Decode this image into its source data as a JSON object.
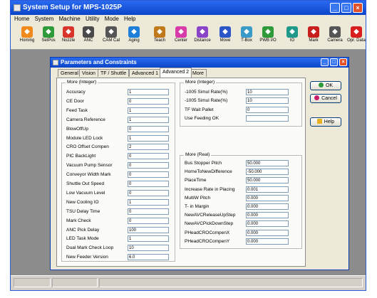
{
  "app": {
    "title": "System Setup for MPS-1025P",
    "menu": [
      "Home",
      "System",
      "Machine",
      "Utility",
      "Mode",
      "Help"
    ]
  },
  "toolbar": [
    {
      "label": "Homing",
      "icon": "home-icon",
      "color": "#f08a1c"
    },
    {
      "label": "SetPos",
      "icon": "person-icon",
      "color": "#2e9a3a"
    },
    {
      "label": "Nozzle",
      "icon": "nozzle-icon",
      "color": "#d8342a"
    },
    {
      "label": "ANC",
      "icon": "anc-icon",
      "color": "#4a4a4a"
    },
    {
      "label": "CAM Cal",
      "icon": "camera-icon",
      "color": "#555555"
    },
    {
      "label": "Aging",
      "icon": "aging-icon",
      "color": "#1e7fd8"
    },
    {
      "label": "Teach",
      "icon": "teach-icon",
      "color": "#c07a1c"
    },
    {
      "label": "Center",
      "icon": "center-icon",
      "color": "#d83aa8"
    },
    {
      "label": "Distance",
      "icon": "distance-icon",
      "color": "#8a44c8"
    },
    {
      "label": "Move",
      "icon": "move-icon",
      "color": "#2a56c8"
    },
    {
      "label": "T-Box",
      "icon": "tbox-icon",
      "color": "#3a9ac8"
    },
    {
      "label": "PWB I/O",
      "icon": "pwb-icon",
      "color": "#2e9a3a"
    },
    {
      "label": "IO",
      "icon": "io-icon",
      "color": "#1f9a8a"
    },
    {
      "label": "Mark",
      "icon": "mark-icon",
      "color": "#c81e1e"
    },
    {
      "label": "Camera",
      "icon": "camera2-icon",
      "color": "#555555"
    },
    {
      "label": "Opr. Data",
      "icon": "data-icon",
      "color": "#d81e1e"
    }
  ],
  "dialog": {
    "title": "Parameters and Constraints",
    "tabs": [
      "General",
      "Vision",
      "TF / Shuttle",
      "Advanced 1",
      "Advanced 2",
      "More"
    ],
    "active_tab": "Advanced 2",
    "buttons": {
      "ok": "OK",
      "cancel": "Cancel",
      "help": "Help"
    },
    "more_integer": {
      "title": "More (Integer)",
      "rows": [
        {
          "label": "Accuracy",
          "value": "1"
        },
        {
          "label": "CE Door",
          "value": "0"
        },
        {
          "label": "Feed Task",
          "value": "1"
        },
        {
          "label": "Camera Reference",
          "value": "1"
        },
        {
          "label": "BlowOffUp",
          "value": "0"
        },
        {
          "label": "Module LED Lock",
          "value": "1"
        },
        {
          "label": "CRO Offset Compen",
          "value": "2"
        },
        {
          "label": "PIC BackLight",
          "value": "0"
        },
        {
          "label": "Vacuum Pump Sensor",
          "value": "0"
        },
        {
          "label": "Conveyor Width Mark",
          "value": "0"
        },
        {
          "label": "Shuttle Out Speed",
          "value": "0"
        },
        {
          "label": "Low Vacuum Level",
          "value": "0"
        },
        {
          "label": "New Cooling IO",
          "value": "1"
        },
        {
          "label": "TSU Delay Time",
          "value": "0"
        },
        {
          "label": "Mark Check",
          "value": "0"
        },
        {
          "label": "ANC Pick Delay",
          "value": "100"
        },
        {
          "label": "LED Task Mode",
          "value": "1"
        },
        {
          "label": "Dual Mark Check Loop",
          "value": "10"
        },
        {
          "label": "New Feeder Version",
          "value": "6.0"
        }
      ]
    },
    "more_integer_right": {
      "title": "More (Integer)",
      "rows": [
        {
          "label": "-1005 Simul Rate(%)",
          "value": "10"
        },
        {
          "label": "-1005 Simul Rate(%)",
          "value": "10"
        },
        {
          "label": "TF Wait Pallet",
          "value": "0"
        },
        {
          "label": "Use Feeding OK",
          "value": ""
        }
      ]
    },
    "more_real": {
      "title": "More (Real)",
      "rows": [
        {
          "label": "Bus Stopper Pitch",
          "value": "50.000"
        },
        {
          "label": "HomeToNewDifference",
          "value": "-50.000"
        },
        {
          "label": "PlaceTime",
          "value": "50.000"
        },
        {
          "label": "Increase Rate in Placing",
          "value": "0.001"
        },
        {
          "label": "MultiW Pitch",
          "value": "0.000"
        },
        {
          "label": "T- in Margin",
          "value": "0.000"
        },
        {
          "label": "NewAVCReleaseUpStep",
          "value": "0.000"
        },
        {
          "label": "NewAVCPickDownStep",
          "value": "0.000"
        },
        {
          "label": "PHeadCROCompenX",
          "value": "0.000"
        },
        {
          "label": "PHeadCROCompenY",
          "value": "0.000"
        }
      ]
    }
  }
}
